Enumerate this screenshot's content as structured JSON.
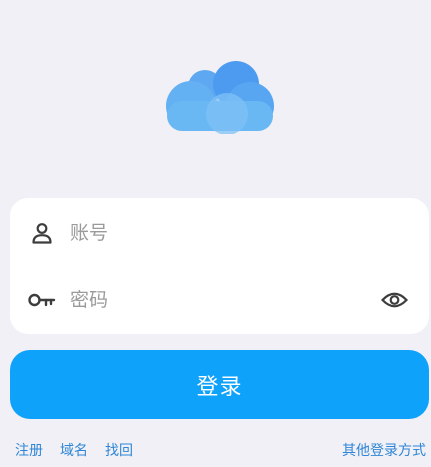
{
  "logo": {
    "icon": "cloud-icon",
    "colors": [
      "#69b7f3",
      "#4f9bf0",
      "#86c5f6"
    ]
  },
  "form": {
    "account": {
      "icon": "user-icon",
      "placeholder": "账号",
      "value": ""
    },
    "password": {
      "icon": "key-icon",
      "placeholder": "密码",
      "value": "",
      "toggle_icon": "eye-icon"
    }
  },
  "login_button": {
    "label": "登录",
    "color": "#0ea2fb"
  },
  "links": {
    "register": "注册",
    "domain": "域名",
    "recover": "找回",
    "other_methods": "其他登录方式",
    "color": "#2f86d6"
  }
}
